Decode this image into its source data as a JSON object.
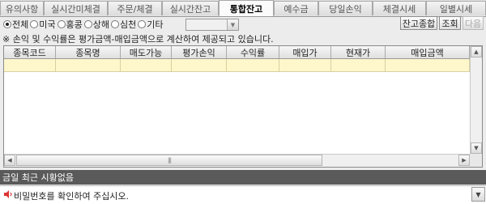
{
  "tabs": [
    {
      "label": "유의사항",
      "active": false
    },
    {
      "label": "실시간미체결",
      "active": false
    },
    {
      "label": "주문/체결",
      "active": false
    },
    {
      "label": "실시간잔고",
      "active": false
    },
    {
      "label": "통합잔고",
      "active": true
    },
    {
      "label": "예수금",
      "active": false
    },
    {
      "label": "당일손익",
      "active": false
    },
    {
      "label": "체결시세",
      "active": false
    },
    {
      "label": "일별시세",
      "active": false
    }
  ],
  "markets": {
    "options": [
      {
        "label": "전체",
        "checked": true
      },
      {
        "label": "미국",
        "checked": false
      },
      {
        "label": "홍콩",
        "checked": false
      },
      {
        "label": "상해",
        "checked": false
      },
      {
        "label": "심천",
        "checked": false
      },
      {
        "label": "기타",
        "checked": false
      }
    ],
    "select_value": ""
  },
  "buttons": {
    "summary": "잔고종합",
    "query": "조회",
    "next": "다음"
  },
  "note": "※ 손익 및 수익률은 평가금액-매입금액으로 계산하여 제공되고 있습니다.",
  "grid": {
    "columns": [
      "종목코드",
      "종목명",
      "매도가능",
      "평가손익",
      "수익률",
      "매입가",
      "현재가",
      "매입금액"
    ],
    "rows": []
  },
  "status": {
    "text": "금일 최근 시황없음"
  },
  "message": {
    "text": "비밀번호를 확인하여 주십시오."
  },
  "colors": {
    "selected_row": "#fff7cc",
    "status_bar": "#5a5a5a"
  }
}
